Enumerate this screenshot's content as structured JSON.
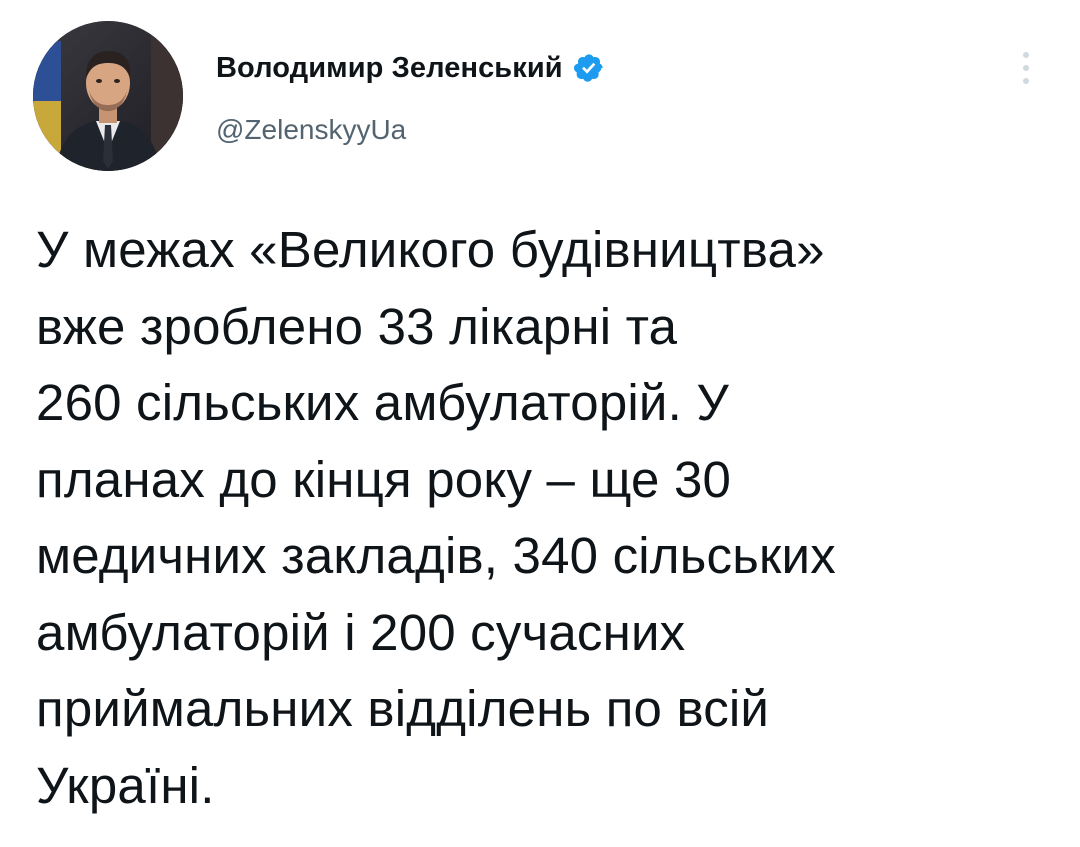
{
  "author": {
    "display_name": "Володимир Зеленський",
    "handle": "@ZelenskyyUa",
    "verified_icon": "verified-badge-icon",
    "verified_color": "#1d9bf0"
  },
  "menu": {
    "icon": "more-options-icon"
  },
  "tweet": {
    "text": "У межах «Великого будівництва»\nвже зроблено 33 лікарні та\n260 сільських амбулаторій. У\nпланах до кінця року – ще 30\nмедичних закладів, 340 сільських\nамбулаторій і 200 сучасних\nприймальних відділень по всій\nУкраїні."
  },
  "colors": {
    "text_primary": "#0f1419",
    "text_secondary": "#536471",
    "background": "#ffffff"
  }
}
